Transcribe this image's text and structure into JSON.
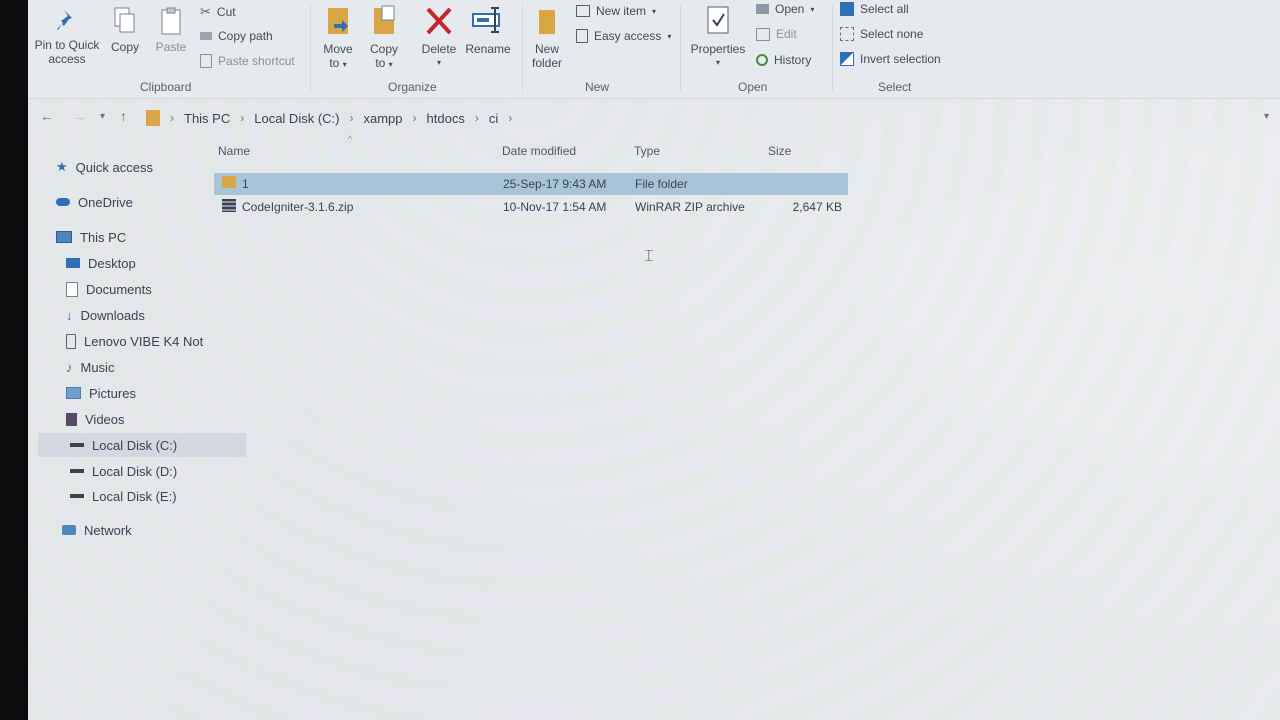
{
  "ribbon": {
    "clipboard": {
      "pin_label": "Pin to Quick access",
      "copy_label": "Copy",
      "paste_label": "Paste",
      "cut_label": "Cut",
      "copy_path_label": "Copy path",
      "paste_shortcut_label": "Paste shortcut",
      "group_label": "Clipboard"
    },
    "organize": {
      "move_to_label": "Move to",
      "copy_to_label": "Copy to",
      "delete_label": "Delete",
      "rename_label": "Rename",
      "group_label": "Organize"
    },
    "new": {
      "new_folder_label": "New folder",
      "new_item_label": "New item",
      "easy_access_label": "Easy access",
      "group_label": "New"
    },
    "open": {
      "properties_label": "Properties",
      "open_label": "Open",
      "edit_label": "Edit",
      "history_label": "History",
      "group_label": "Open"
    },
    "select": {
      "select_all_label": "Select all",
      "select_none_label": "Select none",
      "invert_selection_label": "Invert selection",
      "group_label": "Select"
    }
  },
  "address": {
    "crumbs": [
      "This PC",
      "Local Disk (C:)",
      "xampp",
      "htdocs",
      "ci"
    ]
  },
  "nav": {
    "items": [
      {
        "label": "Quick access",
        "icon": "star-icon"
      },
      {
        "label": "OneDrive",
        "icon": "cloud-icon"
      },
      {
        "label": "This PC",
        "icon": "monitor-icon"
      },
      {
        "label": "Desktop",
        "icon": "desktop-icon"
      },
      {
        "label": "Documents",
        "icon": "document-icon"
      },
      {
        "label": "Downloads",
        "icon": "download-icon"
      },
      {
        "label": "Lenovo VIBE K4 Not",
        "icon": "phone-icon"
      },
      {
        "label": "Music",
        "icon": "music-icon"
      },
      {
        "label": "Pictures",
        "icon": "pictures-icon"
      },
      {
        "label": "Videos",
        "icon": "video-icon"
      },
      {
        "label": "Local Disk (C:)",
        "icon": "drive-icon"
      },
      {
        "label": "Local Disk (D:)",
        "icon": "drive-icon"
      },
      {
        "label": "Local Disk (E:)",
        "icon": "drive-icon"
      },
      {
        "label": "Network",
        "icon": "network-icon"
      }
    ]
  },
  "list": {
    "columns": {
      "name": "Name",
      "date": "Date modified",
      "type": "Type",
      "size": "Size"
    },
    "rows": [
      {
        "name": "1",
        "date": "25-Sep-17 9:43 AM",
        "type": "File folder",
        "size": ""
      },
      {
        "name": "CodeIgniter-3.1.6.zip",
        "date": "10-Nov-17 1:54 AM",
        "type": "WinRAR ZIP archive",
        "size": "2,647 KB"
      }
    ]
  },
  "colors": {
    "selection": "#a8c4d8",
    "delete_red": "#c4262e",
    "folder_yellow": "#d9a646",
    "accent_blue": "#2f6fb5"
  }
}
